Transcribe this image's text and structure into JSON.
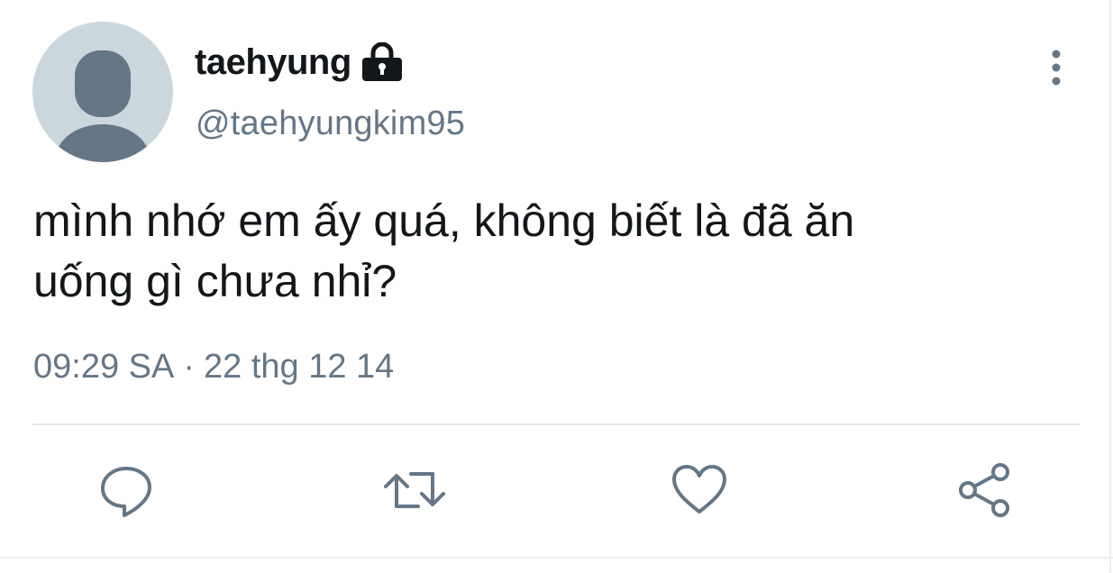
{
  "tweet": {
    "display_name": "taehyung",
    "handle": "@taehyungkim95",
    "text": "mình nhớ em ấy quá, không biết là đã ăn\nuống gì chưa nhỉ?",
    "time": "09:29 SA",
    "separator": "·",
    "date": "22 thg 12 14",
    "protected_icon": "lock-icon",
    "avatar": "default-avatar"
  },
  "actions": [
    {
      "name": "reply",
      "icon": "reply-icon"
    },
    {
      "name": "retweet",
      "icon": "retweet-icon"
    },
    {
      "name": "like",
      "icon": "heart-icon"
    },
    {
      "name": "share",
      "icon": "share-icon"
    }
  ],
  "colors": {
    "text": "#14171a",
    "secondary": "#657786",
    "avatar_bg": "#ccd6dd",
    "avatar_fg": "#657786"
  }
}
